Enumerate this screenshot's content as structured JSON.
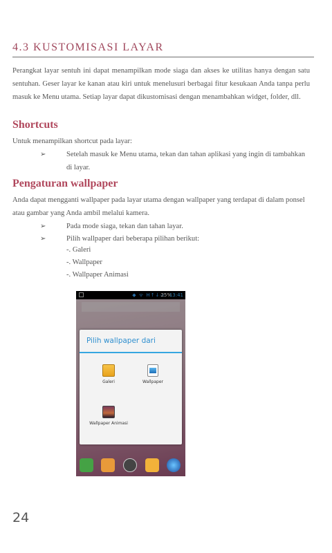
{
  "section_title": "4.3 KUSTOMISASI LAYAR",
  "intro": "Perangkat layar sentuh ini dapat menampilkan mode siaga dan akses ke utilitas hanya dengan satu sentuhan. Geser layar ke kanan atau kiri untuk menelusuri berbagai fitur kesukaan Anda tanpa perlu masuk ke Menu utama. Setiap layar dapat dikustomisasi dengan menambahkan widget, folder, dll.",
  "shortcuts": {
    "heading": "Shortcuts",
    "desc": "Untuk menampilkan shortcut pada layar:",
    "bullets": [
      "Setelah masuk ke Menu utama, tekan dan tahan aplikasi yang ingin di tambahkan di layar."
    ]
  },
  "wallpaper": {
    "heading": "Pengaturan wallpaper",
    "desc": "Anda dapat mengganti wallpaper pada layar utama dengan wallpaper yang terdapat di dalam ponsel atau gambar yang Anda ambil melalui kamera.",
    "bullets": [
      "Pada mode siaga, tekan dan tahan layar.",
      "Pilih wallpaper dari beberapa pilihan berikut:"
    ],
    "sub_items": [
      "-. Galeri",
      "-. Wallpaper",
      "-. Wallpaper Animasi"
    ]
  },
  "bullet_symbol": "➢",
  "phone": {
    "status_icons": "◆ ᯤ H↑↓ᵢₗₗ",
    "battery": "25%",
    "time": "13:41",
    "dialog_title": "Pilih wallpaper dari",
    "options": [
      {
        "label": "Galeri",
        "icon": "gallery-icon"
      },
      {
        "label": "Wallpaper",
        "icon": "wallpaper-icon"
      },
      {
        "label": "Wallpaper Animasi",
        "icon": "live-wallpaper-icon"
      }
    ],
    "accent_color": "#35a6e0"
  },
  "page_number": "24"
}
